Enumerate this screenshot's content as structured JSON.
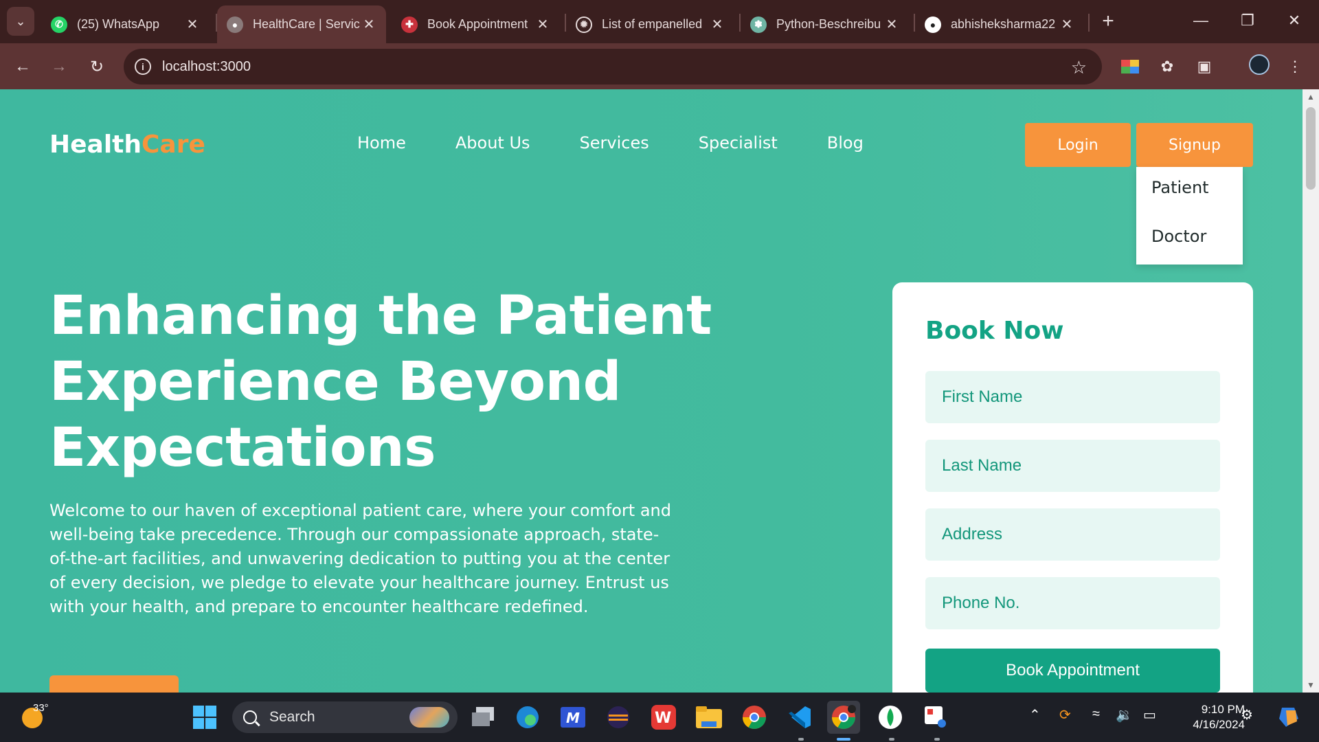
{
  "browser": {
    "tabs": [
      {
        "title": "(25) WhatsApp",
        "icon": "whatsapp-icon",
        "active": false
      },
      {
        "title": "HealthCare | Servic",
        "icon": "globe-icon",
        "active": true
      },
      {
        "title": "Book Appointment",
        "icon": "pill-icon",
        "active": false
      },
      {
        "title": "List of empanelled",
        "icon": "seal-icon",
        "active": false
      },
      {
        "title": "Python-Beschreibu",
        "icon": "openai-icon",
        "active": false
      },
      {
        "title": "abhisheksharma22",
        "icon": "github-icon",
        "active": false
      }
    ],
    "url": "localhost:3000"
  },
  "site": {
    "logo_main": "Health",
    "logo_accent": "Care",
    "nav": [
      "Home",
      "About Us",
      "Services",
      "Specialist",
      "Blog"
    ],
    "login_label": "Login",
    "signup_label": "Signup",
    "signup_menu": [
      "Patient",
      "Doctor"
    ],
    "hero_title": "Enhancing the Patient Experience Beyond Expectations",
    "hero_text": "Welcome to our haven of exceptional patient care, where your comfort and well-being take precedence. Through our compassionate approach, state-of-the-art facilities, and unwavering dedication to putting you at the center of every decision, we pledge to elevate your healthcare journey. Entrust us with your health, and prepare to encounter healthcare redefined.",
    "book": {
      "heading": "Book Now",
      "fields": [
        "First Name",
        "Last Name",
        "Address",
        "Phone No."
      ],
      "button": "Book Appointment"
    },
    "colors": {
      "primary": "#13a384",
      "accent": "#f7943c",
      "hero_bg": "#43bb9e"
    }
  },
  "taskbar": {
    "temperature": "33°",
    "search_label": "Search",
    "time": "9:10 PM",
    "date": "4/16/2024"
  }
}
